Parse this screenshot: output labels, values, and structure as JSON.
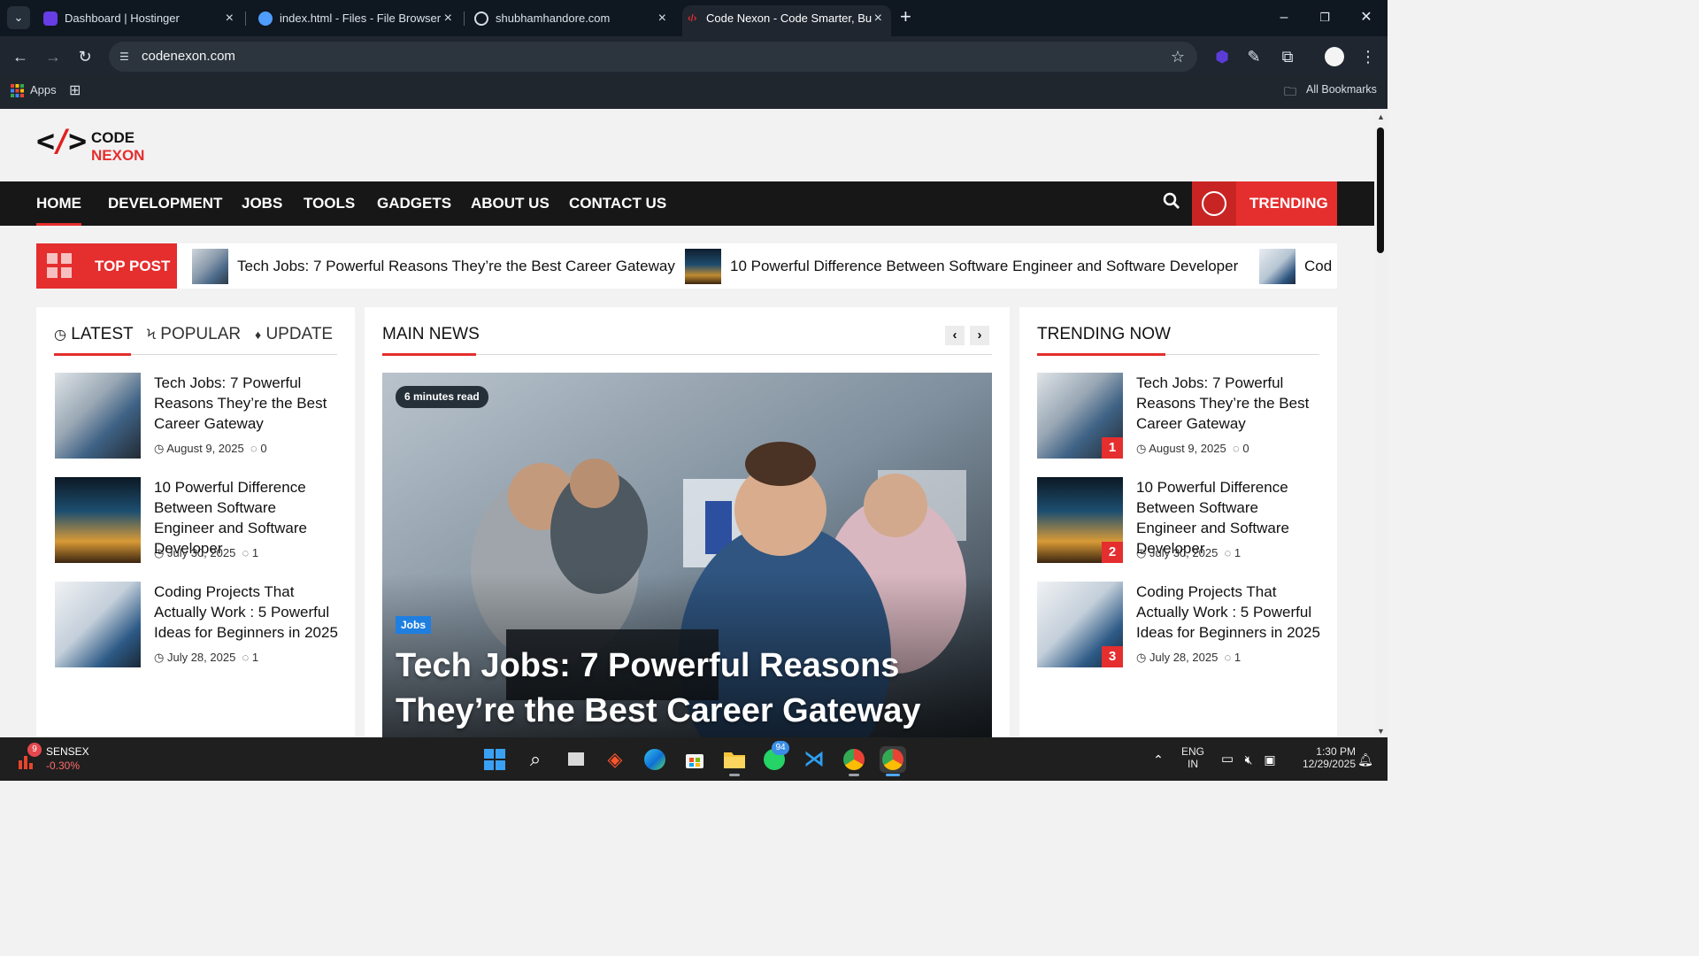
{
  "browser": {
    "tabs": [
      {
        "title": "Dashboard | Hostinger",
        "active": false,
        "favicon_color": "#673de6"
      },
      {
        "title": "index.html - Files - File Browser",
        "active": false,
        "favicon_color": "#4f9cff"
      },
      {
        "title": "shubhamhandore.com",
        "active": false,
        "favicon_color": "#e6edf3"
      },
      {
        "title": "Code Nexon - Code Smarter, Bu",
        "active": true,
        "favicon_color": "#ffffff"
      }
    ],
    "url": "codenexon.com",
    "bookmarks": {
      "apps_label": "Apps",
      "all_label": "All Bookmarks"
    }
  },
  "site": {
    "logo": {
      "mark_left": "<",
      "mark_slash": "/",
      "mark_right": ">",
      "word1": "CODE",
      "word2": "NEXON"
    },
    "nav": [
      "HOME",
      "DEVELOPMENT",
      "JOBS",
      "TOOLS",
      "GADGETS",
      "ABOUT US",
      "CONTACT US"
    ],
    "trending_label": "TRENDING",
    "ticker": {
      "label": "TOP POST",
      "items": [
        "Tech Jobs: 7 Powerful Reasons They’re the Best Career Gateway",
        "10 Powerful Difference Between Software Engineer and Software Developer",
        "Cod"
      ]
    },
    "left_tabs": [
      "LATEST",
      "POPULAR",
      "UPDATE"
    ],
    "main_title": "MAIN NEWS",
    "trending_title": "TRENDING NOW",
    "posts": [
      {
        "title": "Tech Jobs: 7 Powerful Reasons They’re the Best Career Gateway",
        "date": "August 9, 2025",
        "comments": "0",
        "rank": "1"
      },
      {
        "title": "10 Powerful Difference Between Software Engineer and Software Developer",
        "date": "July 30, 2025",
        "comments": "1",
        "rank": "2"
      },
      {
        "title": "Coding Projects That Actually Work : 5 Powerful Ideas for Beginners in 2025",
        "date": "July 28, 2025",
        "comments": "1",
        "rank": "3"
      }
    ],
    "hero": {
      "read_time": "6 minutes read",
      "category": "Jobs",
      "title": "Tech Jobs: 7 Powerful Reasons They’re the Best Career Gateway"
    }
  },
  "taskbar": {
    "stock": {
      "name": "SENSEX",
      "change": "-0.30%",
      "badge": "9"
    },
    "whatsapp_badge": "94",
    "lang": "ENG",
    "region": "IN",
    "time": "1:30 PM",
    "date": "12/29/2025"
  },
  "colors": {
    "accent": "#e52e2e",
    "nav_bg": "#171717",
    "tab_strip": "#0f1721"
  }
}
